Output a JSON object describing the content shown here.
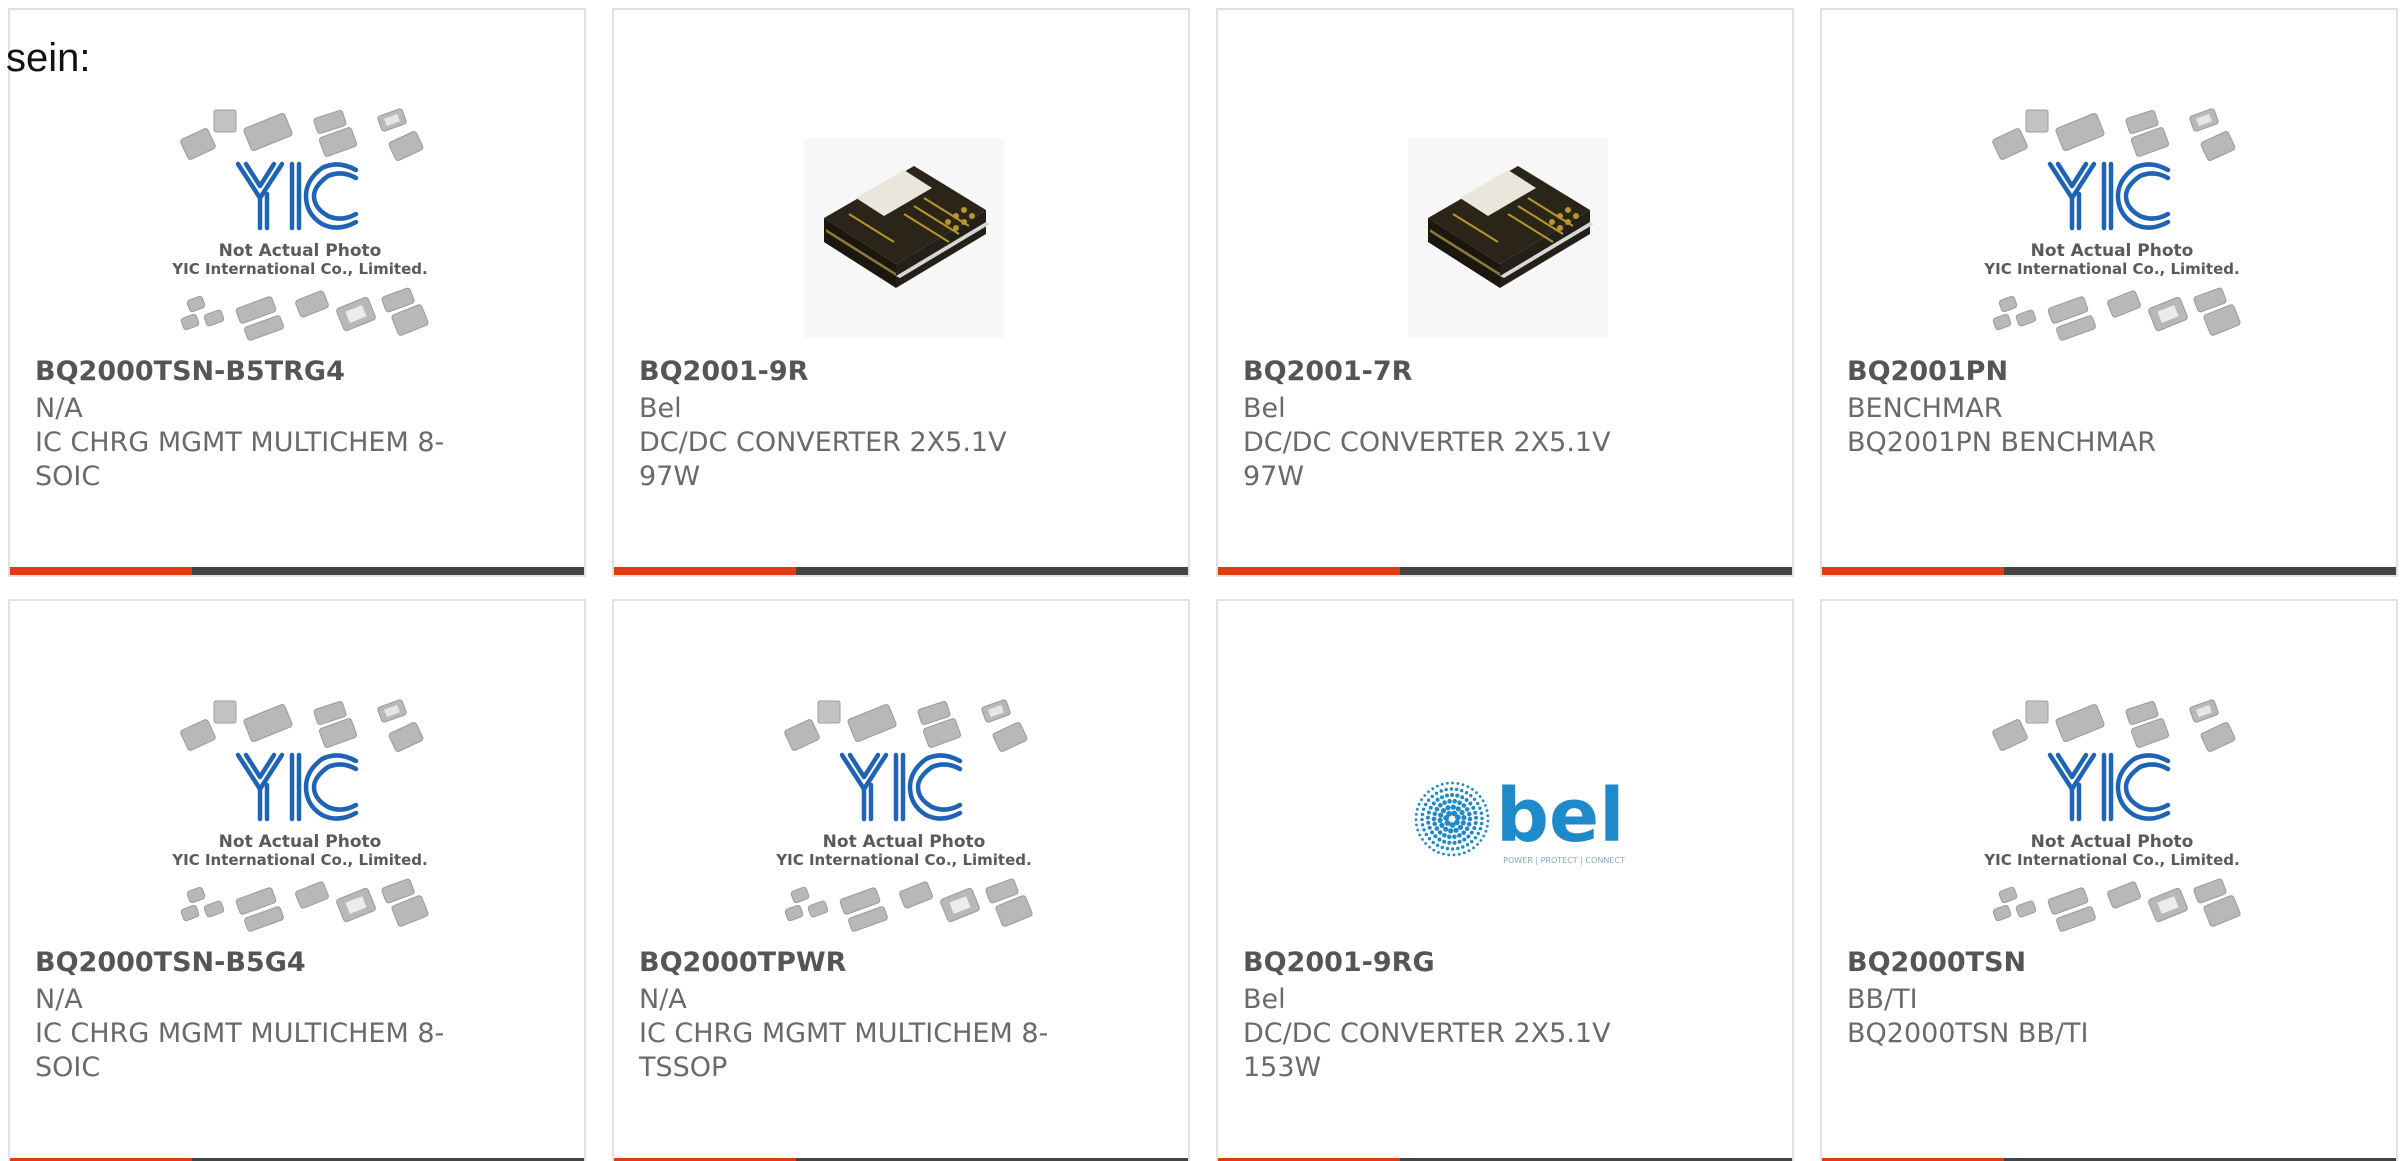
{
  "heading_fragment": "sein:",
  "colors": {
    "card_border": "#e1e1e1",
    "bar_dark": "#444444",
    "bar_accent": "#e03c0f",
    "yic_blue": "#1e63b5",
    "bel_blue": "#1f8ac9"
  },
  "placeholder": {
    "brand": "YIC",
    "line1": "Not Actual Photo",
    "line2": "YIC International Co., Limited."
  },
  "bel_logo": {
    "word": "bel",
    "tagline": "POWER | PROTECT | CONNECT"
  },
  "products": [
    {
      "part": "BQ2000TSN-B5TRG4",
      "mfr": "N/A",
      "desc": "IC CHRG MGMT MULTICHEM 8-SOIC",
      "image": "yic-placeholder"
    },
    {
      "part": "BQ2001-9R",
      "mfr": "Bel",
      "desc": "DC/DC CONVERTER 2X5.1V 97W",
      "image": "converter-photo"
    },
    {
      "part": "BQ2001-7R",
      "mfr": "Bel",
      "desc": "DC/DC CONVERTER 2X5.1V 97W",
      "image": "converter-photo"
    },
    {
      "part": "BQ2001PN",
      "mfr": "BENCHMAR",
      "desc": "BQ2001PN BENCHMAR",
      "image": "yic-placeholder"
    },
    {
      "part": "BQ2000TSN-B5G4",
      "mfr": "N/A",
      "desc": "IC CHRG MGMT MULTICHEM 8-SOIC",
      "image": "yic-placeholder"
    },
    {
      "part": "BQ2000TPWR",
      "mfr": "N/A",
      "desc": "IC CHRG MGMT MULTICHEM 8-TSSOP",
      "image": "yic-placeholder"
    },
    {
      "part": "BQ2001-9RG",
      "mfr": "Bel",
      "desc": "DC/DC CONVERTER 2X5.1V 153W",
      "image": "bel-logo"
    },
    {
      "part": "BQ2000TSN",
      "mfr": "BB/TI",
      "desc": "BQ2000TSN BB/TI",
      "image": "yic-placeholder"
    }
  ]
}
